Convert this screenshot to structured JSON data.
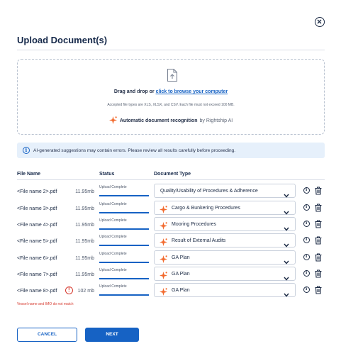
{
  "dialog": {
    "title": "Upload Document(s)"
  },
  "dropzone": {
    "drag_text": "Drag and drop or ",
    "browse_link": "click to browse your computer",
    "accepted_note": "Accepted file types are XLS, XLSX, and CSV. Each file must not exceed 100 MB.",
    "ai_label": "Automatic document recognition",
    "ai_by": "by Rightship AI"
  },
  "banner": {
    "text": "AI-generated suggestions may contain errors. Please review all results carefully before proceeding."
  },
  "table": {
    "headers": {
      "file_name": "File Name",
      "status": "Status",
      "document_type": "Document Type"
    },
    "rows": [
      {
        "file": "<File name 2>.pdf",
        "size": "11.95mb",
        "status": "Upload Complete",
        "progress_pct": 100,
        "doc_type": "Quality/Usability of Procedures & Adherence",
        "ai_suggested": false,
        "error": false
      },
      {
        "file": "<File name 3>.pdf",
        "size": "11.95mb",
        "status": "Upload Complete",
        "progress_pct": 100,
        "doc_type": "Cargo & Bunkering Procedures",
        "ai_suggested": true,
        "error": false
      },
      {
        "file": "<File name 4>.pdf",
        "size": "11.95mb",
        "status": "Upload Complete",
        "progress_pct": 100,
        "doc_type": "Mooring Procedures",
        "ai_suggested": true,
        "error": false
      },
      {
        "file": "<File name 5>.pdf",
        "size": "11.95mb",
        "status": "Upload Complete",
        "progress_pct": 100,
        "doc_type": "Result of External Audits",
        "ai_suggested": true,
        "error": false
      },
      {
        "file": "<File name 6>.pdf",
        "size": "11.95mb",
        "status": "Upload Complete",
        "progress_pct": 100,
        "doc_type": "GA Plan",
        "ai_suggested": true,
        "error": false
      },
      {
        "file": "<File name 7>.pdf",
        "size": "11.95mb",
        "status": "Upload Complete",
        "progress_pct": 100,
        "doc_type": "GA Plan",
        "ai_suggested": true,
        "error": false
      },
      {
        "file": "<File name 8>.pdf",
        "size": "102 mb",
        "status": "Upload Complete",
        "progress_pct": 100,
        "doc_type": "GA Plan",
        "ai_suggested": true,
        "error": true
      }
    ],
    "error_message": "Vessel name and IMO do not match"
  },
  "footer": {
    "cancel_label": "CANCEL",
    "next_label": "NEXT"
  },
  "colors": {
    "primary": "#1662c4",
    "ai_accent": "#f26a2e",
    "error": "#d63a2f",
    "banner_bg": "#e6f0fb"
  },
  "icons": {
    "close": "close-circle-icon",
    "upload_file": "file-upload-icon",
    "ai": "sparkle-icon",
    "info": "info-icon",
    "warning": "warning-icon",
    "delete": "trash-icon",
    "dropdown": "chevron-down-icon"
  }
}
